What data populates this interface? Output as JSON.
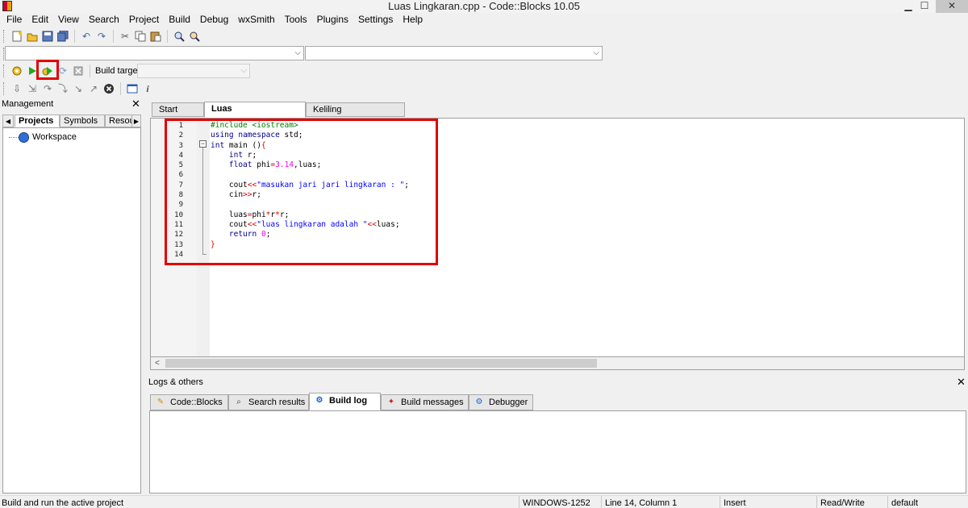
{
  "window": {
    "title": "Luas Lingkaran.cpp - Code::Blocks 10.05",
    "minimize": "▁",
    "maximize": "☐",
    "close": "✕"
  },
  "menu": [
    "File",
    "Edit",
    "View",
    "Search",
    "Project",
    "Build",
    "Debug",
    "wxSmith",
    "Tools",
    "Plugins",
    "Settings",
    "Help"
  ],
  "toolbar": {
    "build_target_label": "Build target:",
    "build_target_value": ""
  },
  "management": {
    "title": "Management",
    "tabs": [
      "Projects",
      "Symbols",
      "Resou"
    ],
    "active_tab": "Projects",
    "tree": [
      {
        "label": "Workspace"
      }
    ]
  },
  "editor": {
    "tabs": [
      {
        "label": "Start here",
        "active": false
      },
      {
        "label": "Luas Lingkaran.cpp",
        "active": true
      },
      {
        "label": "Keliling Lingkaran.cpp",
        "active": false
      }
    ],
    "line_numbers": [
      "1",
      "2",
      "3",
      "4",
      "5",
      "6",
      "7",
      "8",
      "9",
      "10",
      "11",
      "12",
      "13",
      "14"
    ],
    "code_lines": [
      "#include <iostream>",
      "using namespace std;",
      "int main (){",
      "    int r;",
      "    float phi=3.14,luas;",
      "",
      "    cout<<\"masukan jari jari lingkaran : \";",
      "    cin>>r;",
      "",
      "    luas=phi*r*r;",
      "    cout<<\"luas lingkaran adalah \"<<luas;",
      "    return 0;",
      "}",
      ""
    ]
  },
  "logs": {
    "title": "Logs & others",
    "tabs": [
      {
        "label": "Code::Blocks",
        "icon": "pencil-icon",
        "active": false
      },
      {
        "label": "Search results",
        "icon": "search-icon",
        "active": false
      },
      {
        "label": "Build log",
        "icon": "gear-log-icon",
        "active": true
      },
      {
        "label": "Build messages",
        "icon": "pin-icon",
        "active": false
      },
      {
        "label": "Debugger",
        "icon": "debugger-icon",
        "active": false
      }
    ]
  },
  "status": {
    "message": "Build and run the active project",
    "encoding": "WINDOWS-1252",
    "position": "Line 14, Column 1",
    "mode": "Insert",
    "access": "Read/Write",
    "lang": "default"
  },
  "colors": {
    "highlight": "#e30000",
    "keyword": "#00008b",
    "preprocessor": "#008000",
    "string": "#0000ff",
    "number": "#f000f0"
  }
}
